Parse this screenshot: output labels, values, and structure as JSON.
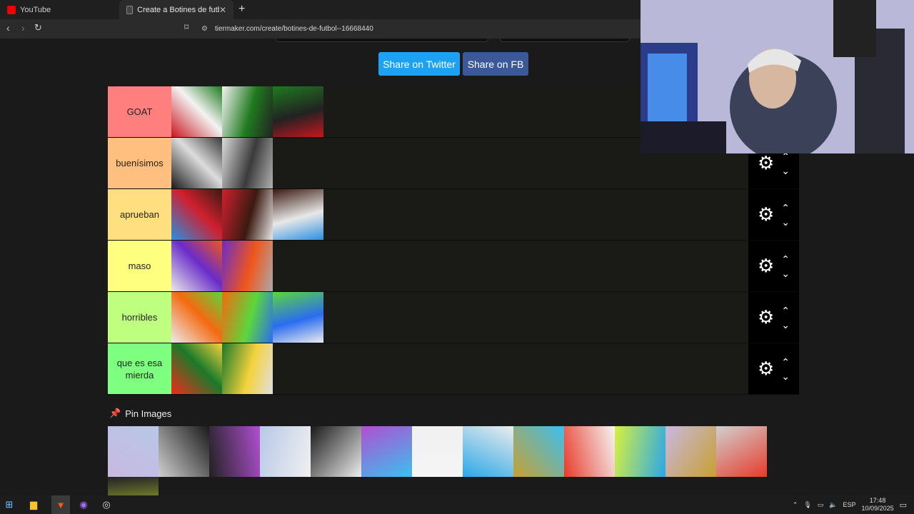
{
  "browser": {
    "tabs": [
      {
        "label": "YouTube",
        "active": false
      },
      {
        "label": "Create a Botines de futbol Tier Li",
        "active": true
      }
    ],
    "url": "tiermaker.com/create/botines-de-futbol--16668440"
  },
  "share": {
    "twitter_label": "Share on Twitter",
    "fb_label": "Share on FB"
  },
  "tiers": [
    {
      "label": "GOAT",
      "color": "#ff7f7f",
      "items": 3
    },
    {
      "label": "buenísimos",
      "color": "#ffbf7f",
      "items": 2
    },
    {
      "label": "aprueban",
      "color": "#ffdf7f",
      "items": 3
    },
    {
      "label": "maso",
      "color": "#ffff7f",
      "items": 2
    },
    {
      "label": "horribles",
      "color": "#bfff7f",
      "items": 3
    },
    {
      "label": "que es esa mierda",
      "color": "#7fff7f",
      "items": 2
    }
  ],
  "pin": {
    "label": "Pin Images"
  },
  "pool_count": 14,
  "taskbar": {
    "lang": "ESP",
    "time": "17:48",
    "date": "10/09/2025"
  },
  "icons": {
    "gear": "gear-icon",
    "up": "chevron-up-icon",
    "down": "chevron-down-icon",
    "pin": "pushpin-icon"
  },
  "colors": {
    "twitter": "#1da1f2",
    "facebook": "#3b5998"
  }
}
